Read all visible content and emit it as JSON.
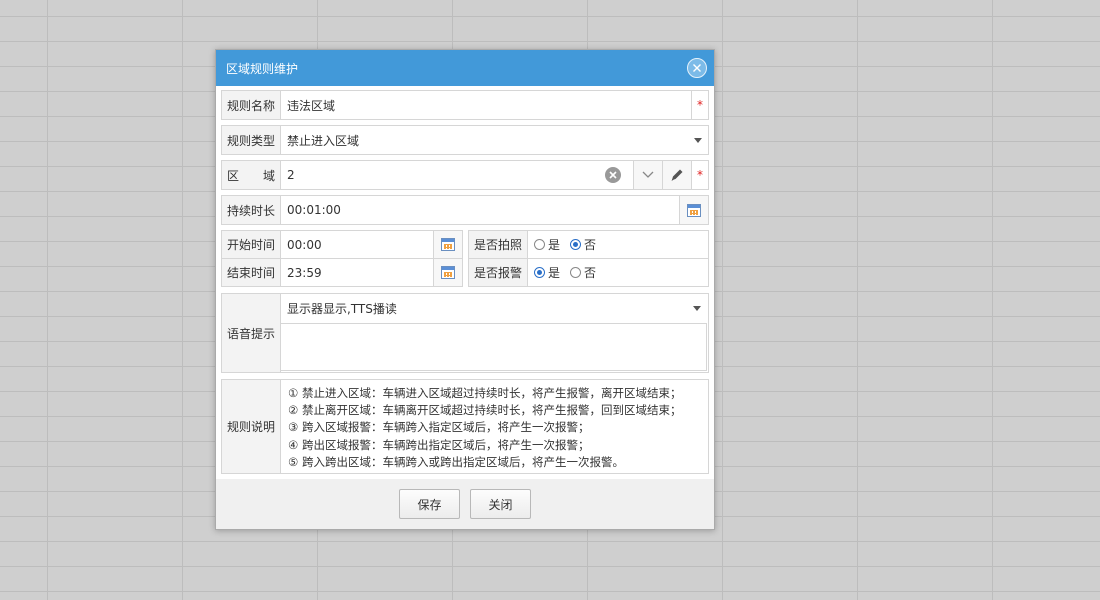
{
  "dialog": {
    "title": "区域规则维护",
    "fields": {
      "rule_name": {
        "label": "规则名称",
        "value": "违法区域",
        "required": "*"
      },
      "rule_type": {
        "label": "规则类型",
        "value": "禁止进入区域"
      },
      "region": {
        "label": "区　　域",
        "value": "2",
        "required": "*"
      },
      "duration": {
        "label": "持续时长",
        "value": "00:01:00"
      },
      "start_time": {
        "label": "开始时间",
        "value": "00:00"
      },
      "end_time": {
        "label": "结束时间",
        "value": "23:59"
      },
      "photo": {
        "label": "是否拍照",
        "options": [
          "是",
          "否"
        ],
        "selected": "否"
      },
      "alarm": {
        "label": "是否报警",
        "options": [
          "是",
          "否"
        ],
        "selected": "是"
      },
      "voice": {
        "label": "语音提示",
        "value": "显示器显示,TTS播读",
        "text": ""
      },
      "description": {
        "label": "规则说明",
        "lines": [
          "① 禁止进入区域：车辆进入区域超过持续时长，将产生报警，离开区域结束；",
          "② 禁止离开区域：车辆离开区域超过持续时长，将产生报警，回到区域结束；",
          "③ 跨入区域报警：车辆跨入指定区域后，将产生一次报警；",
          "④ 跨出区域报警：车辆跨出指定区域后，将产生一次报警；",
          "⑤ 跨入跨出区域：车辆跨入或跨出指定区域后，将产生一次报警。"
        ]
      }
    },
    "buttons": {
      "save": "保存",
      "close": "关闭"
    }
  },
  "icons": [
    "close-icon",
    "clear-icon",
    "chevron-down-icon",
    "pencil-icon",
    "calendar-icon",
    "dropdown-caret-icon"
  ],
  "colors": {
    "titlebar": "#4299d9",
    "required": "#e02020",
    "radio_selected": "#2a6fc8"
  }
}
